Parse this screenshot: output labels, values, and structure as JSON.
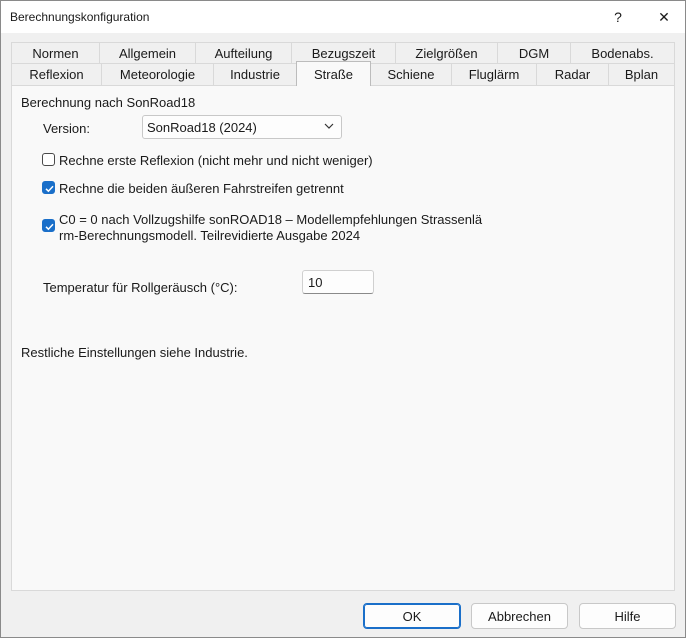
{
  "window": {
    "title": "Berechnungskonfiguration",
    "help_glyph": "?",
    "close_glyph": "✕"
  },
  "tabs": {
    "row1": [
      "Normen",
      "Allgemein",
      "Aufteilung",
      "Bezugszeit",
      "Zielgrößen",
      "DGM",
      "Bodenabs."
    ],
    "row2": [
      "Reflexion",
      "Meteorologie",
      "Industrie",
      "Straße",
      "Schiene",
      "Fluglärm",
      "Radar",
      "Bplan"
    ],
    "active": "Straße"
  },
  "panel": {
    "section_label": "Berechnung nach SonRoad18",
    "version_label": "Version:",
    "version_value": "SonRoad18 (2024)",
    "checkbox_reflexion": {
      "label": "Rechne erste Reflexion (nicht mehr und nicht weniger)",
      "checked": false
    },
    "checkbox_fahrstreifen": {
      "label": "Rechne die beiden äußeren Fahrstreifen getrennt",
      "checked": true
    },
    "checkbox_c0": {
      "label_line1": "C0 = 0 nach Vollzugshilfe sonROAD18 – Modellempfehlungen Strassenlä",
      "label_line2": "rm-Berechnungsmodell. Teilrevidierte Ausgabe 2024",
      "checked": true
    },
    "temperature_label": "Temperatur für Rollgeräusch (°C):",
    "temperature_value": "10",
    "footer_note": "Restliche Einstellungen siehe Industrie."
  },
  "buttons": {
    "ok": "OK",
    "cancel": "Abbrechen",
    "help": "Hilfe"
  },
  "colors": {
    "accent": "#1a6fc9",
    "dialog_bg": "#f0f0f0",
    "panel_bg": "#f9f9f9"
  }
}
